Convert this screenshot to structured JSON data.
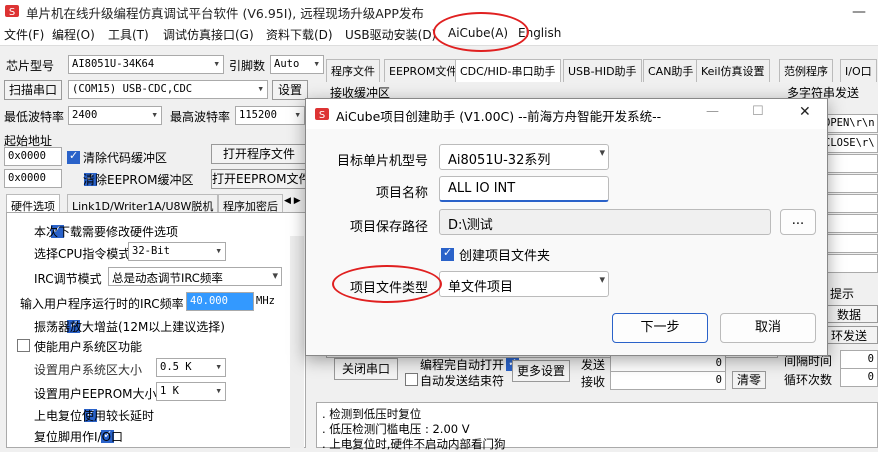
{
  "window": {
    "title": "单片机在线升级编程仿真调试平台软件 (V6.95I), 远程现场升级APP发布",
    "minimize": "—"
  },
  "menu": [
    "文件(F)",
    "编程(O)",
    "工具(T)",
    "调试仿真接口(G)",
    "资料下载(D)",
    "USB驱动安装(D)",
    "AiCube(A)",
    "English"
  ],
  "left": {
    "chip_label": "芯片型号",
    "chip_value": "AI8051U-34K64",
    "pin_label": "引脚数",
    "pin_value": "Auto",
    "scan_btn": "扫描串口",
    "port_value": "(COM15) USB-CDC,CDC",
    "settings_btn": "设置",
    "min_baud_label": "最低波特率",
    "min_baud_value": "2400",
    "max_baud_label": "最高波特率",
    "max_baud_value": "115200",
    "start_addr_label": "起始地址",
    "addr1": "0x0000",
    "clear_code_label": "清除代码缓冲区",
    "open_prog_btn": "打开程序文件",
    "addr2": "0x0000",
    "clear_eeprom_label": "清除EEPROM缓冲区",
    "open_eeprom_btn": "打开EEPROM文件",
    "tabs": [
      "硬件选项",
      "Link1D/Writer1A/U8W脱机",
      "程序加密后"
    ],
    "tab_scroll": "◀ ▶",
    "options": {
      "modify_hw": "本次下载需要修改硬件选项",
      "cpu_mode_label": "选择CPU指令模式",
      "cpu_mode_value": "32-Bit",
      "irc_mode_label": "IRC调节模式",
      "irc_mode_value": "总是动态调节IRC频率",
      "irc_freq_label": "输入用户程序运行时的IRC频率",
      "irc_freq_value": "40.000",
      "irc_freq_unit": "MHz",
      "osc_gain": "振荡器放大增益(12M以上建议选择)",
      "user_sys_area": "使能用户系统区功能",
      "user_sys_size_label": "设置用户系统区大小",
      "user_sys_size_value": "0.5 K",
      "user_eeprom_label": "设置用户EEPROM大小",
      "user_eeprom_value": "1   K",
      "power_reset": "上电复位使用较长延时",
      "reset_pin": "复位脚用作I/O口"
    }
  },
  "right": {
    "tabs": [
      "程序文件",
      "EEPROM文件",
      "CDC/HID-串口助手",
      "USB-HID助手",
      "CAN助手",
      "Keil仿真设置",
      "范例程序",
      "I/O口"
    ],
    "recv_label": "接收缓冲区",
    "multi_label": "多字符串发送",
    "multi_items": [
      "OPEN\\r\\n",
      "CLOSE\\r\\"
    ],
    "hint_label": "提示",
    "data_label": "数据",
    "send_label": "环发送",
    "interval_label": "间隔时间",
    "interval_value": "0",
    "loop_label": "循环次数",
    "loop_value": "0",
    "close_port_btn": "关闭串口",
    "auto_open_label": "编程完自动打开",
    "auto_send_label": "自动发送结束符",
    "more_settings_btn": "更多设置",
    "send_stat_label": "发送",
    "recv_stat_label": "接收",
    "send_count": "0",
    "recv_count": "0",
    "clear_btn": "清零",
    "log_lines": [
      ". 检测到低压时复位",
      ". 低压检测门槛电压 : 2.00 V",
      ". 上电复位时,硬件不启动内部看门狗"
    ]
  },
  "dialog": {
    "title": "AiCube项目创建助手 (V1.00C) --前海方舟智能开发系统--",
    "close": "✕",
    "max": "☐",
    "min": "—",
    "chip_label": "目标单片机型号",
    "chip_value": "Ai8051U-32系列",
    "name_label": "项目名称",
    "name_value": "ALL IO INT",
    "path_label": "项目保存路径",
    "path_value": "D:\\测试",
    "browse_btn": "...",
    "create_folder_label": "创建项目文件夹",
    "type_label": "项目文件类型",
    "type_value": "单文件项目",
    "next_btn": "下一步",
    "cancel_btn": "取消"
  },
  "colors": {
    "accent": "#2a62c9",
    "highlight": "#e02020",
    "selection": "#3399ff"
  }
}
